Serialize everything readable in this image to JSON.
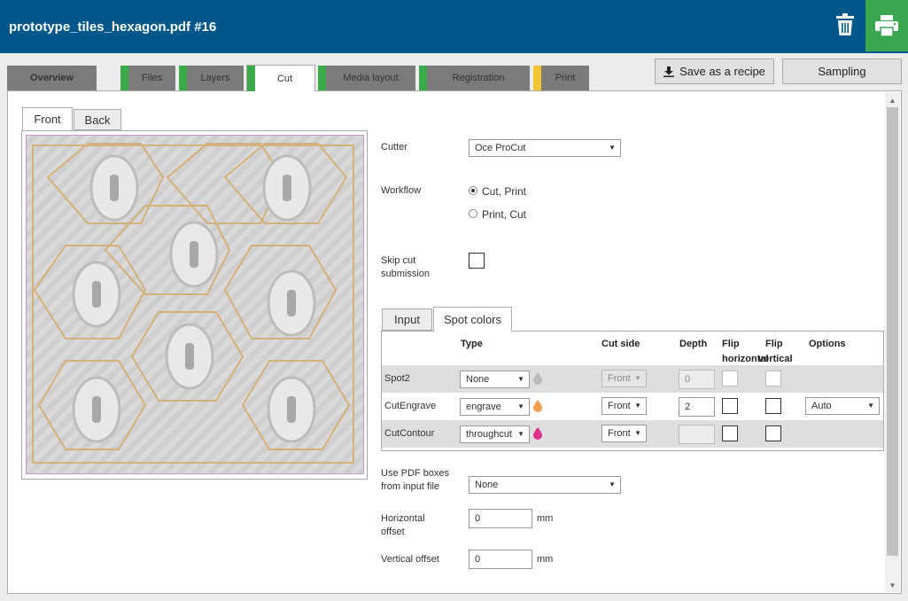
{
  "window": {
    "title": "prototype_tiles_hexagon.pdf #16"
  },
  "tabs": [
    {
      "label": "Overview",
      "stripe": ""
    },
    {
      "label": "Files",
      "stripe": "#3aaa4a"
    },
    {
      "label": "Layers",
      "stripe": "#3aaa4a"
    },
    {
      "label": "Cut",
      "stripe": "#3aaa4a"
    },
    {
      "label": "Media layout",
      "stripe": "#3aaa4a"
    },
    {
      "label": "Registration",
      "stripe": "#3aaa4a"
    },
    {
      "label": "Print",
      "stripe": "#f2c733"
    }
  ],
  "toolbar": {
    "save_recipe_label": "Save as a recipe",
    "sampling_label": "Sampling"
  },
  "preview": {
    "tabs": [
      "Front",
      "Back"
    ]
  },
  "form": {
    "cutter_label": "Cutter",
    "cutter_value": "Oce ProCut",
    "workflow_label": "Workflow",
    "workflow_options": [
      "Cut, Print",
      "Print, Cut"
    ],
    "skip_label_line1": "Skip cut",
    "skip_label_line2": "submission",
    "pdf_boxes_line1": "Use PDF boxes",
    "pdf_boxes_line2": "from input file",
    "pdf_boxes_value": "None",
    "hoffset_line1": "Horizontal",
    "hoffset_line2": "offset",
    "hoffset_value": "0",
    "voffset_label": "Vertical offset",
    "voffset_value": "0",
    "unit": "mm"
  },
  "spot_tabs": [
    "Input",
    "Spot colors"
  ],
  "spot_table": {
    "headers": {
      "type": "Type",
      "cut_side": "Cut side",
      "depth": "Depth",
      "flip_h_line1": "Flip",
      "flip_h_line2": "horizontal",
      "flip_v_line1": "Flip",
      "flip_v_line2": "vertical",
      "options": "Options"
    },
    "rows": [
      {
        "name": "Spot2",
        "type": "None",
        "cut_side": "Front",
        "depth": "0",
        "drop_color": "#bbbbbb",
        "options": ""
      },
      {
        "name": "CutEngrave",
        "type": "engrave",
        "cut_side": "Front",
        "depth": "2",
        "drop_color": "#f0a050",
        "options": "Auto"
      },
      {
        "name": "CutContour",
        "type": "throughcut",
        "cut_side": "Front",
        "depth": "",
        "drop_color": "#e0308a",
        "options": ""
      }
    ]
  }
}
